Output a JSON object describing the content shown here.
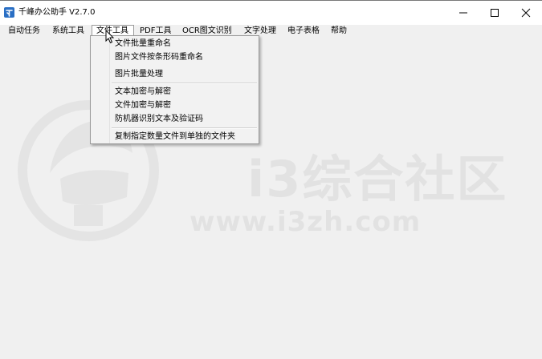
{
  "window": {
    "title": "千峰办公助手 V2.7.0",
    "controls": {
      "minimize": "minimize-icon",
      "maximize": "maximize-icon",
      "close": "close-icon"
    }
  },
  "menubar": {
    "items": [
      {
        "label": "自动任务"
      },
      {
        "label": "系统工具"
      },
      {
        "label": "文件工具",
        "active": true
      },
      {
        "label": "PDF工具"
      },
      {
        "label": "OCR图文识别"
      },
      {
        "label": "文字处理"
      },
      {
        "label": "电子表格"
      },
      {
        "label": "帮助"
      }
    ]
  },
  "dropdown": {
    "items": [
      {
        "label": "文件批量重命名"
      },
      {
        "label": "图片文件按条形码重命名"
      },
      {
        "label": "图片批量处理"
      },
      {
        "label": "文本加密与解密"
      },
      {
        "label": "文件加密与解密"
      },
      {
        "label": "防机器识别文本及验证码"
      },
      {
        "label": "复制指定数量文件到单独的文件夹"
      }
    ]
  },
  "watermark": {
    "brand": "i3综合社区",
    "url": "www.i3zh.com"
  },
  "colors": {
    "titlebar_bg": "#ffffff",
    "client_bg": "#f0f0f0",
    "menu_bg": "#f2f2f2",
    "app_icon": "#2a6fc4",
    "watermark": "#e2e2e2"
  }
}
